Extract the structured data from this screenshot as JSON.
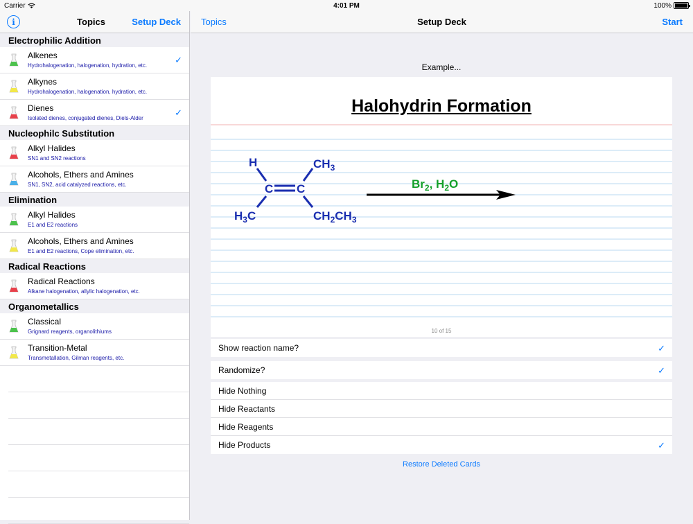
{
  "status_bar": {
    "carrier": "Carrier",
    "time": "4:01 PM",
    "battery": "100%"
  },
  "left_nav": {
    "title": "Topics",
    "setup_label": "Setup Deck"
  },
  "sections": [
    {
      "header": "Electrophilic Addition",
      "rows": [
        {
          "title": "Alkenes",
          "subtitle": "Hydrohalogenation, halogenation, hydration, etc.",
          "flask": "green",
          "checked": true
        },
        {
          "title": "Alkynes",
          "subtitle": "Hydrohalogenation, halogenation, hydration, etc.",
          "flask": "yellow",
          "checked": false
        },
        {
          "title": "Dienes",
          "subtitle": "Isolated dienes, conjugated dienes, Diels-Alder",
          "flask": "red",
          "checked": true
        }
      ]
    },
    {
      "header": "Nucleophilc Substitution",
      "rows": [
        {
          "title": "Alkyl Halides",
          "subtitle": "SN1 and SN2 reactions",
          "flask": "red",
          "checked": false
        },
        {
          "title": "Alcohols, Ethers and Amines",
          "subtitle": "SN1, SN2, acid catalyzed reactions, etc.",
          "flask": "blue",
          "checked": false
        }
      ]
    },
    {
      "header": "Elimination",
      "rows": [
        {
          "title": "Alkyl Halides",
          "subtitle": "E1 and E2 reactions",
          "flask": "green",
          "checked": false
        },
        {
          "title": "Alcohols, Ethers and Amines",
          "subtitle": "E1 and E2 reactions, Cope elimination, etc.",
          "flask": "yellow",
          "checked": false
        }
      ]
    },
    {
      "header": "Radical Reactions",
      "rows": [
        {
          "title": "Radical Reactions",
          "subtitle": "Alkane halogenation, allylic halogenation, etc.",
          "flask": "red",
          "checked": false
        }
      ]
    },
    {
      "header": "Organometallics",
      "rows": [
        {
          "title": "Classical",
          "subtitle": "Grignard reagents, organolithiums",
          "flask": "green",
          "checked": false
        },
        {
          "title": "Transition-Metal",
          "subtitle": "Transmetallation, Gilman reagents, etc.",
          "flask": "yellow",
          "checked": false
        }
      ]
    }
  ],
  "flask_colors": {
    "green": "#4cc24c",
    "yellow": "#f2e84a",
    "red": "#e8404a",
    "blue": "#4ab0e8"
  },
  "right_nav": {
    "back_label": "Topics",
    "title": "Setup Deck",
    "start_label": "Start"
  },
  "example_label": "Example...",
  "card": {
    "title": "Halohydrin Formation",
    "count": "10 of 15",
    "reagent": "Br",
    "reagent_sub": "2",
    "reagent_2": ", H",
    "reagent_sub_2": "2",
    "reagent_3": "O",
    "molecule": {
      "h": "H",
      "ch3_top": "CH",
      "ch3_top_sub": "3",
      "c_left": "C",
      "c_right": "C",
      "h3c_h": "H",
      "h3c_sub": "3",
      "h3c_c": "C",
      "ch2ch3_ch": "CH",
      "ch2ch3_sub1": "2",
      "ch2ch3_ch2": "CH",
      "ch2ch3_sub2": "3"
    }
  },
  "options_1": [
    {
      "label": "Show reaction name?",
      "checked": true
    }
  ],
  "options_2": [
    {
      "label": "Randomize?",
      "checked": true
    }
  ],
  "options_3": [
    {
      "label": "Hide Nothing",
      "checked": false
    },
    {
      "label": "Hide Reactants",
      "checked": false
    },
    {
      "label": "Hide Reagents",
      "checked": false
    },
    {
      "label": "Hide Products",
      "checked": true
    }
  ],
  "restore_label": "Restore Deleted Cards"
}
